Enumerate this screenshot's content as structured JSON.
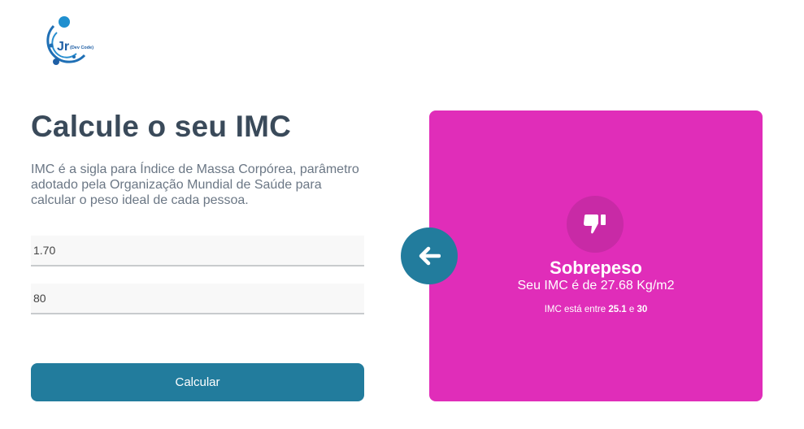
{
  "logo": {
    "text": "Jr (Dev Code)"
  },
  "title": "Calcule o seu IMC",
  "description": "IMC é a sigla para Índice de Massa Corpórea, parâmetro adotado pela Organização Mundial de Saúde para calcular o peso ideal de cada pessoa.",
  "form": {
    "height_value": "1.70",
    "weight_value": "80",
    "submit_label": "Calcular"
  },
  "result": {
    "status": "Sobrepeso",
    "imc_text": "Seu IMC é de 27.68 Kg/m2",
    "range_prefix": "IMC está entre",
    "range_min": "25.1",
    "range_joiner": "e",
    "range_max": "30",
    "icon": "thumbs-down-icon",
    "color": "#e02db9"
  },
  "colors": {
    "primary": "#227c9d",
    "title": "#3a4a5a"
  }
}
